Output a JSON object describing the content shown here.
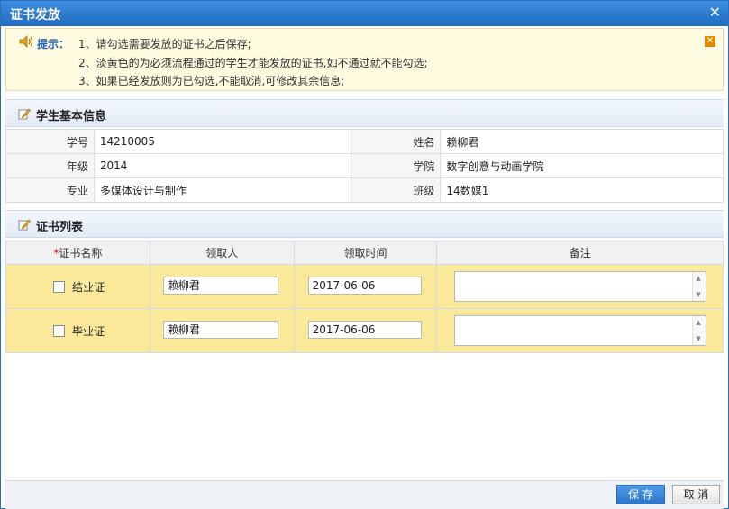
{
  "window": {
    "title": "证书发放",
    "close_symbol": "✕"
  },
  "tip": {
    "label": "提示：",
    "lines": [
      "1、请勾选需要发放的证书之后保存;",
      "2、淡黄色的为必须流程通过的学生才能发放的证书,如不通过就不能勾选;",
      "3、如果已经发放则为已勾选,不能取消,可修改其余信息;"
    ],
    "close_symbol": "✕",
    "icon": "speaker-icon"
  },
  "student_section": {
    "title": "学生基本信息",
    "icon": "edit-icon"
  },
  "student": {
    "rows": [
      {
        "l1": "学号",
        "v1": "14210005",
        "l2": "姓名",
        "v2": "赖柳君"
      },
      {
        "l1": "年级",
        "v1": "2014",
        "l2": "学院",
        "v2": "数字创意与动画学院"
      },
      {
        "l1": "专业",
        "v1": "多媒体设计与制作",
        "l2": "班级",
        "v2": "14数媒1"
      }
    ]
  },
  "cert_section": {
    "title": "证书列表",
    "icon": "edit-icon"
  },
  "cert_table": {
    "headers": {
      "required_mark": "*",
      "name": "证书名称",
      "receiver": "领取人",
      "time": "领取时间",
      "note": "备注"
    },
    "rows": [
      {
        "name": "结业证",
        "receiver": "赖柳君",
        "time": "2017-06-06",
        "note": "",
        "checked": false
      },
      {
        "name": "毕业证",
        "receiver": "赖柳君",
        "time": "2017-06-06",
        "note": "",
        "checked": false
      }
    ],
    "row_color": "#fbe99a"
  },
  "footer": {
    "save": "保 存",
    "cancel": "取 消"
  },
  "colors": {
    "title_bar": "#1f6cc4",
    "tip_bg": "#fffbe0",
    "save_button": "#2c78cf"
  }
}
